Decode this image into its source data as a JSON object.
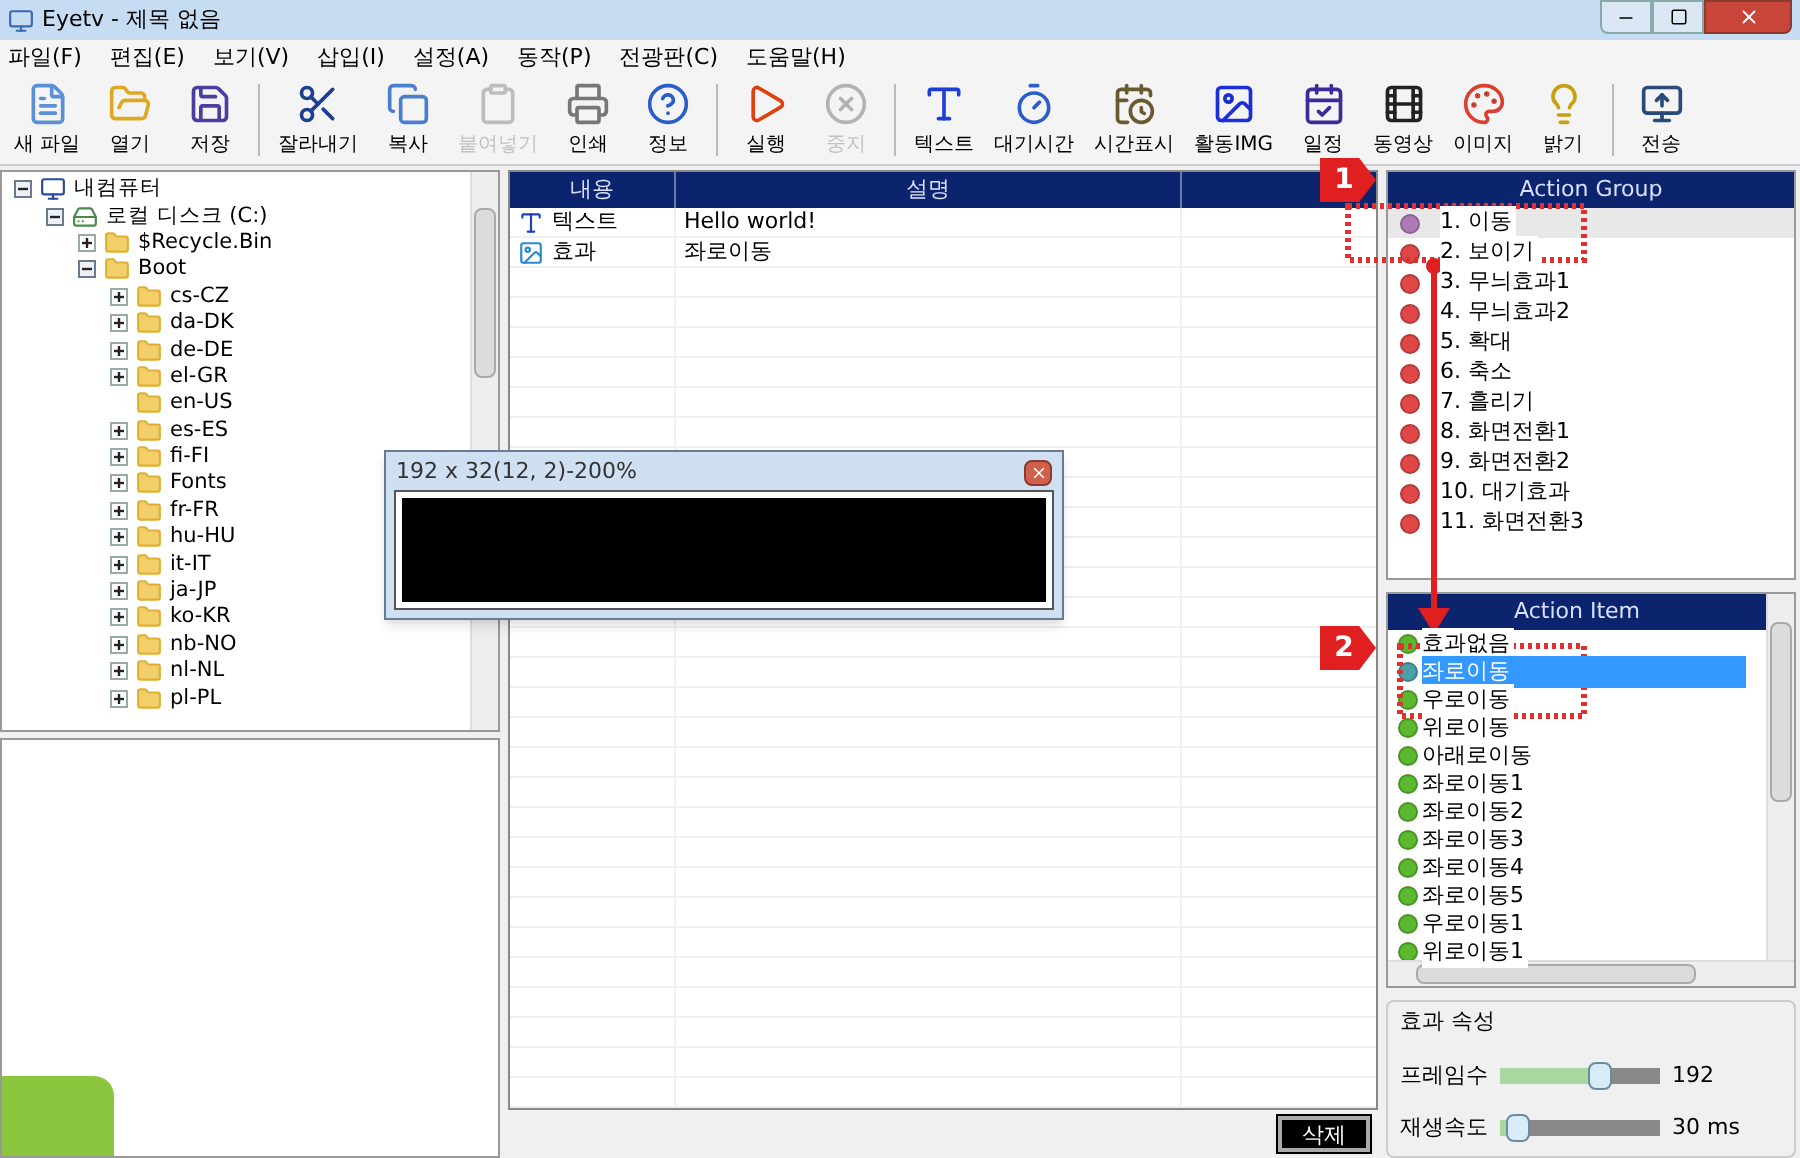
{
  "window": {
    "title": "Eyetv - 제목 없음"
  },
  "menu": [
    "파일(F)",
    "편집(E)",
    "보기(V)",
    "삽입(I)",
    "설정(A)",
    "동작(P)",
    "전광판(C)",
    "도움말(H)"
  ],
  "toolbar": [
    [
      {
        "kind": "new",
        "label": "새 파일",
        "disabled": false
      },
      {
        "kind": "open",
        "label": "열기",
        "disabled": false
      },
      {
        "kind": "save",
        "label": "저장",
        "disabled": false
      }
    ],
    [
      {
        "kind": "cut",
        "label": "잘라내기",
        "disabled": false
      },
      {
        "kind": "copy",
        "label": "복사",
        "disabled": false
      },
      {
        "kind": "paste",
        "label": "붙여넣기",
        "disabled": true
      },
      {
        "kind": "print",
        "label": "인쇄",
        "disabled": false
      },
      {
        "kind": "info",
        "label": "정보",
        "disabled": false
      }
    ],
    [
      {
        "kind": "run",
        "label": "실행",
        "disabled": false
      },
      {
        "kind": "stop",
        "label": "중지",
        "disabled": true
      }
    ],
    [
      {
        "kind": "text",
        "label": "텍스트",
        "disabled": false
      },
      {
        "kind": "wait",
        "label": "대기시간",
        "disabled": false
      },
      {
        "kind": "clock",
        "label": "시간표시",
        "disabled": false
      },
      {
        "kind": "img",
        "label": "활동IMG",
        "disabled": false
      },
      {
        "kind": "schedule",
        "label": "일정",
        "disabled": false
      },
      {
        "kind": "video",
        "label": "동영상",
        "disabled": false
      },
      {
        "kind": "image",
        "label": "이미지",
        "disabled": false
      },
      {
        "kind": "bright",
        "label": "밝기",
        "disabled": false
      }
    ],
    [
      {
        "kind": "send",
        "label": "전송",
        "disabled": false
      }
    ]
  ],
  "tree": [
    {
      "label": "내컴퓨터",
      "kind": "computer",
      "expandable": true,
      "expanded": true,
      "children": [
        {
          "label": "로컬 디스크 (C:)",
          "kind": "disk",
          "expandable": true,
          "expanded": true,
          "children": [
            {
              "label": "$Recycle.Bin",
              "kind": "folder",
              "expandable": true,
              "expanded": false
            },
            {
              "label": "Boot",
              "kind": "folder",
              "expandable": true,
              "expanded": true,
              "children": [
                {
                  "label": "cs-CZ",
                  "kind": "folder",
                  "expandable": true,
                  "expanded": false
                },
                {
                  "label": "da-DK",
                  "kind": "folder",
                  "expandable": true,
                  "expanded": false
                },
                {
                  "label": "de-DE",
                  "kind": "folder",
                  "expandable": true,
                  "expanded": false
                },
                {
                  "label": "el-GR",
                  "kind": "folder",
                  "expandable": true,
                  "expanded": false
                },
                {
                  "label": "en-US",
                  "kind": "folder",
                  "expandable": false,
                  "expanded": false
                },
                {
                  "label": "es-ES",
                  "kind": "folder",
                  "expandable": true,
                  "expanded": false
                },
                {
                  "label": "fi-FI",
                  "kind": "folder",
                  "expandable": true,
                  "expanded": false
                },
                {
                  "label": "Fonts",
                  "kind": "folder",
                  "expandable": true,
                  "expanded": false
                },
                {
                  "label": "fr-FR",
                  "kind": "folder",
                  "expandable": true,
                  "expanded": false
                },
                {
                  "label": "hu-HU",
                  "kind": "folder",
                  "expandable": true,
                  "expanded": false
                },
                {
                  "label": "it-IT",
                  "kind": "folder",
                  "expandable": true,
                  "expanded": false
                },
                {
                  "label": "ja-JP",
                  "kind": "folder",
                  "expandable": true,
                  "expanded": false
                },
                {
                  "label": "ko-KR",
                  "kind": "folder",
                  "expandable": true,
                  "expanded": false
                },
                {
                  "label": "nb-NO",
                  "kind": "folder",
                  "expandable": true,
                  "expanded": false
                },
                {
                  "label": "nl-NL",
                  "kind": "folder",
                  "expandable": true,
                  "expanded": false
                },
                {
                  "label": "pl-PL",
                  "kind": "folder",
                  "expandable": true,
                  "expanded": false
                }
              ]
            }
          ]
        }
      ]
    }
  ],
  "table": {
    "columns": [
      "내용",
      "설명"
    ],
    "rows": [
      {
        "kind": "text",
        "cells": [
          "텍스트",
          "Hello world!"
        ]
      },
      {
        "kind": "effect",
        "cells": [
          "효과",
          "좌로이동"
        ]
      }
    ]
  },
  "delete_button": "삭제",
  "preview_window": {
    "title": "192 x 32(12, 2)-200%"
  },
  "action_group": {
    "title": "Action Group",
    "items": [
      {
        "label": "1. 이동",
        "color": "#b07ab8",
        "selected": true
      },
      {
        "label": "2. 보이기",
        "color": "#e04848",
        "selected": false
      },
      {
        "label": "3. 무늬효과1",
        "color": "#e04848",
        "selected": false
      },
      {
        "label": "4. 무늬효과2",
        "color": "#e04848",
        "selected": false
      },
      {
        "label": "5. 확대",
        "color": "#e04848",
        "selected": false
      },
      {
        "label": "6. 축소",
        "color": "#e04848",
        "selected": false
      },
      {
        "label": "7. 흘리기",
        "color": "#e04848",
        "selected": false
      },
      {
        "label": "8. 화면전환1",
        "color": "#e04848",
        "selected": false
      },
      {
        "label": "9. 화면전환2",
        "color": "#e04848",
        "selected": false
      },
      {
        "label": "10. 대기효과",
        "color": "#e04848",
        "selected": false
      },
      {
        "label": "11. 화면전환3",
        "color": "#e04848",
        "selected": false
      }
    ]
  },
  "action_item": {
    "title": "Action Item",
    "items": [
      {
        "label": "효과없음",
        "color": "#5cb82e",
        "selected": false
      },
      {
        "label": "좌로이동",
        "color": "#4aa0a8",
        "selected": true
      },
      {
        "label": "우로이동",
        "color": "#5cb82e",
        "selected": false
      },
      {
        "label": "위로이동",
        "color": "#5cb82e",
        "selected": false
      },
      {
        "label": "아래로이동",
        "color": "#5cb82e",
        "selected": false
      },
      {
        "label": "좌로이동1",
        "color": "#5cb82e",
        "selected": false
      },
      {
        "label": "좌로이동2",
        "color": "#5cb82e",
        "selected": false
      },
      {
        "label": "좌로이동3",
        "color": "#5cb82e",
        "selected": false
      },
      {
        "label": "좌로이동4",
        "color": "#5cb82e",
        "selected": false
      },
      {
        "label": "좌로이동5",
        "color": "#5cb82e",
        "selected": false
      },
      {
        "label": "우로이동1",
        "color": "#5cb82e",
        "selected": false
      },
      {
        "label": "위로이동1",
        "color": "#5cb82e",
        "selected": false
      }
    ]
  },
  "effect_properties": {
    "title": "효과 속성",
    "sliders": [
      {
        "label": "프레임수",
        "level": 0.65,
        "reading": "192"
      },
      {
        "label": "재생속도",
        "level": 0.05,
        "reading": "30 ms"
      }
    ]
  },
  "annotations": {
    "markers": [
      {
        "label": "1"
      },
      {
        "label": "2"
      }
    ]
  }
}
